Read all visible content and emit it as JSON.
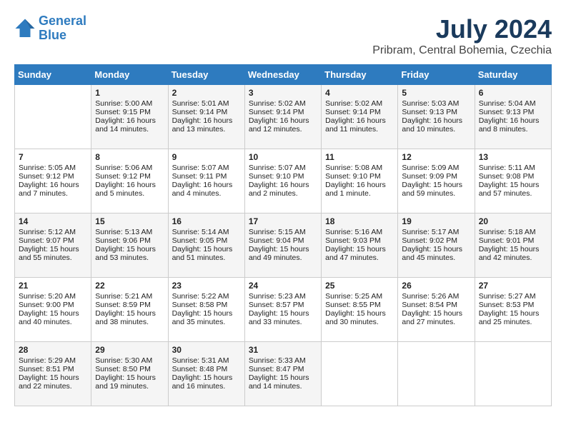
{
  "logo": {
    "line1": "General",
    "line2": "Blue"
  },
  "title": "July 2024",
  "location": "Pribram, Central Bohemia, Czechia",
  "days_of_week": [
    "Sunday",
    "Monday",
    "Tuesday",
    "Wednesday",
    "Thursday",
    "Friday",
    "Saturday"
  ],
  "weeks": [
    [
      {
        "day": "",
        "sunrise": "",
        "sunset": "",
        "daylight": ""
      },
      {
        "day": "1",
        "sunrise": "Sunrise: 5:00 AM",
        "sunset": "Sunset: 9:15 PM",
        "daylight": "Daylight: 16 hours and 14 minutes."
      },
      {
        "day": "2",
        "sunrise": "Sunrise: 5:01 AM",
        "sunset": "Sunset: 9:14 PM",
        "daylight": "Daylight: 16 hours and 13 minutes."
      },
      {
        "day": "3",
        "sunrise": "Sunrise: 5:02 AM",
        "sunset": "Sunset: 9:14 PM",
        "daylight": "Daylight: 16 hours and 12 minutes."
      },
      {
        "day": "4",
        "sunrise": "Sunrise: 5:02 AM",
        "sunset": "Sunset: 9:14 PM",
        "daylight": "Daylight: 16 hours and 11 minutes."
      },
      {
        "day": "5",
        "sunrise": "Sunrise: 5:03 AM",
        "sunset": "Sunset: 9:13 PM",
        "daylight": "Daylight: 16 hours and 10 minutes."
      },
      {
        "day": "6",
        "sunrise": "Sunrise: 5:04 AM",
        "sunset": "Sunset: 9:13 PM",
        "daylight": "Daylight: 16 hours and 8 minutes."
      }
    ],
    [
      {
        "day": "7",
        "sunrise": "Sunrise: 5:05 AM",
        "sunset": "Sunset: 9:12 PM",
        "daylight": "Daylight: 16 hours and 7 minutes."
      },
      {
        "day": "8",
        "sunrise": "Sunrise: 5:06 AM",
        "sunset": "Sunset: 9:12 PM",
        "daylight": "Daylight: 16 hours and 5 minutes."
      },
      {
        "day": "9",
        "sunrise": "Sunrise: 5:07 AM",
        "sunset": "Sunset: 9:11 PM",
        "daylight": "Daylight: 16 hours and 4 minutes."
      },
      {
        "day": "10",
        "sunrise": "Sunrise: 5:07 AM",
        "sunset": "Sunset: 9:10 PM",
        "daylight": "Daylight: 16 hours and 2 minutes."
      },
      {
        "day": "11",
        "sunrise": "Sunrise: 5:08 AM",
        "sunset": "Sunset: 9:10 PM",
        "daylight": "Daylight: 16 hours and 1 minute."
      },
      {
        "day": "12",
        "sunrise": "Sunrise: 5:09 AM",
        "sunset": "Sunset: 9:09 PM",
        "daylight": "Daylight: 15 hours and 59 minutes."
      },
      {
        "day": "13",
        "sunrise": "Sunrise: 5:11 AM",
        "sunset": "Sunset: 9:08 PM",
        "daylight": "Daylight: 15 hours and 57 minutes."
      }
    ],
    [
      {
        "day": "14",
        "sunrise": "Sunrise: 5:12 AM",
        "sunset": "Sunset: 9:07 PM",
        "daylight": "Daylight: 15 hours and 55 minutes."
      },
      {
        "day": "15",
        "sunrise": "Sunrise: 5:13 AM",
        "sunset": "Sunset: 9:06 PM",
        "daylight": "Daylight: 15 hours and 53 minutes."
      },
      {
        "day": "16",
        "sunrise": "Sunrise: 5:14 AM",
        "sunset": "Sunset: 9:05 PM",
        "daylight": "Daylight: 15 hours and 51 minutes."
      },
      {
        "day": "17",
        "sunrise": "Sunrise: 5:15 AM",
        "sunset": "Sunset: 9:04 PM",
        "daylight": "Daylight: 15 hours and 49 minutes."
      },
      {
        "day": "18",
        "sunrise": "Sunrise: 5:16 AM",
        "sunset": "Sunset: 9:03 PM",
        "daylight": "Daylight: 15 hours and 47 minutes."
      },
      {
        "day": "19",
        "sunrise": "Sunrise: 5:17 AM",
        "sunset": "Sunset: 9:02 PM",
        "daylight": "Daylight: 15 hours and 45 minutes."
      },
      {
        "day": "20",
        "sunrise": "Sunrise: 5:18 AM",
        "sunset": "Sunset: 9:01 PM",
        "daylight": "Daylight: 15 hours and 42 minutes."
      }
    ],
    [
      {
        "day": "21",
        "sunrise": "Sunrise: 5:20 AM",
        "sunset": "Sunset: 9:00 PM",
        "daylight": "Daylight: 15 hours and 40 minutes."
      },
      {
        "day": "22",
        "sunrise": "Sunrise: 5:21 AM",
        "sunset": "Sunset: 8:59 PM",
        "daylight": "Daylight: 15 hours and 38 minutes."
      },
      {
        "day": "23",
        "sunrise": "Sunrise: 5:22 AM",
        "sunset": "Sunset: 8:58 PM",
        "daylight": "Daylight: 15 hours and 35 minutes."
      },
      {
        "day": "24",
        "sunrise": "Sunrise: 5:23 AM",
        "sunset": "Sunset: 8:57 PM",
        "daylight": "Daylight: 15 hours and 33 minutes."
      },
      {
        "day": "25",
        "sunrise": "Sunrise: 5:25 AM",
        "sunset": "Sunset: 8:55 PM",
        "daylight": "Daylight: 15 hours and 30 minutes."
      },
      {
        "day": "26",
        "sunrise": "Sunrise: 5:26 AM",
        "sunset": "Sunset: 8:54 PM",
        "daylight": "Daylight: 15 hours and 27 minutes."
      },
      {
        "day": "27",
        "sunrise": "Sunrise: 5:27 AM",
        "sunset": "Sunset: 8:53 PM",
        "daylight": "Daylight: 15 hours and 25 minutes."
      }
    ],
    [
      {
        "day": "28",
        "sunrise": "Sunrise: 5:29 AM",
        "sunset": "Sunset: 8:51 PM",
        "daylight": "Daylight: 15 hours and 22 minutes."
      },
      {
        "day": "29",
        "sunrise": "Sunrise: 5:30 AM",
        "sunset": "Sunset: 8:50 PM",
        "daylight": "Daylight: 15 hours and 19 minutes."
      },
      {
        "day": "30",
        "sunrise": "Sunrise: 5:31 AM",
        "sunset": "Sunset: 8:48 PM",
        "daylight": "Daylight: 15 hours and 16 minutes."
      },
      {
        "day": "31",
        "sunrise": "Sunrise: 5:33 AM",
        "sunset": "Sunset: 8:47 PM",
        "daylight": "Daylight: 15 hours and 14 minutes."
      },
      {
        "day": "",
        "sunrise": "",
        "sunset": "",
        "daylight": ""
      },
      {
        "day": "",
        "sunrise": "",
        "sunset": "",
        "daylight": ""
      },
      {
        "day": "",
        "sunrise": "",
        "sunset": "",
        "daylight": ""
      }
    ]
  ]
}
